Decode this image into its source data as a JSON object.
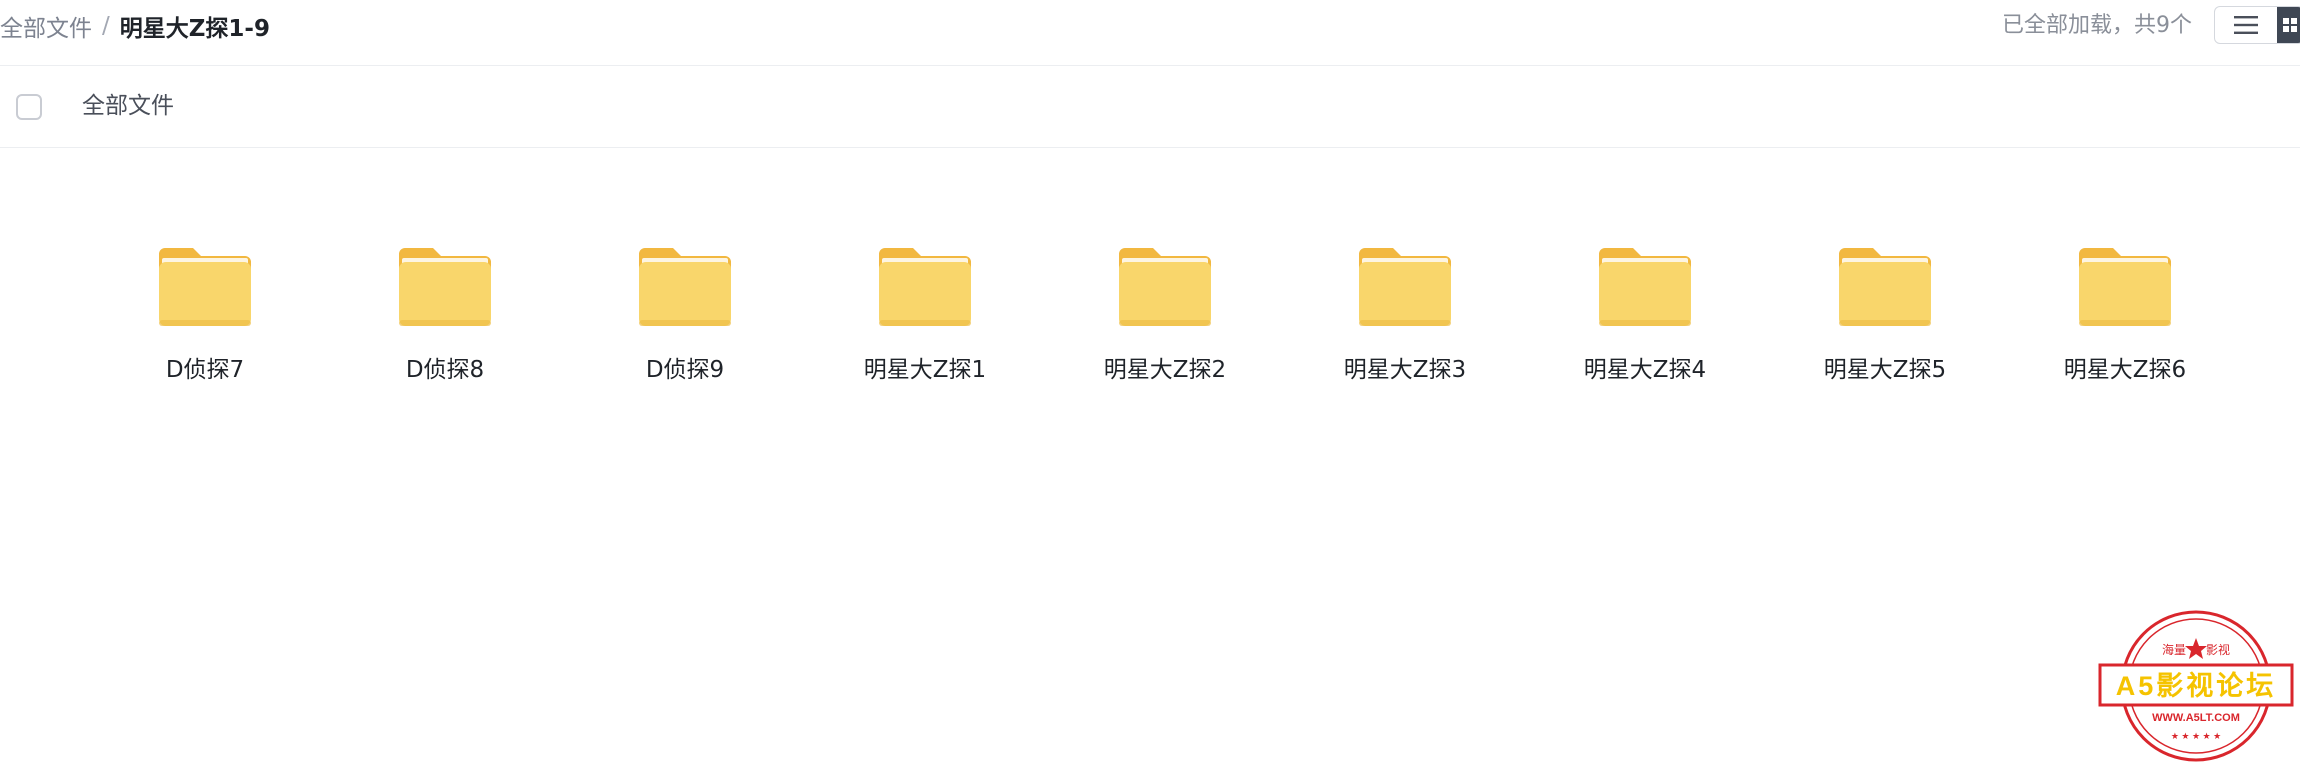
{
  "breadcrumb": {
    "root": "全部文件",
    "separator": "/",
    "current": "明星大Z探1-9"
  },
  "status": {
    "loaded_text": "已全部加载，共9个"
  },
  "view_toggle": {
    "list_icon": "list-icon",
    "grid_icon": "grid-icon"
  },
  "header": {
    "label": "全部文件"
  },
  "folders": [
    {
      "name": "D侦探7",
      "icon": "folder-icon"
    },
    {
      "name": "D侦探8",
      "icon": "folder-icon"
    },
    {
      "name": "D侦探9",
      "icon": "folder-icon"
    },
    {
      "name": "明星大Z探1",
      "icon": "folder-icon"
    },
    {
      "name": "明星大Z探2",
      "icon": "folder-icon"
    },
    {
      "name": "明星大Z探3",
      "icon": "folder-icon"
    },
    {
      "name": "明星大Z探4",
      "icon": "folder-icon"
    },
    {
      "name": "明星大Z探5",
      "icon": "folder-icon"
    },
    {
      "name": "明星大Z探6",
      "icon": "folder-icon"
    }
  ],
  "watermark": {
    "title": "A5影视论坛",
    "top_left": "海量",
    "top_right": "影视",
    "url": "WWW.A5LT.COM",
    "colors": {
      "ring": "#d9262c",
      "text": "#f5c300"
    }
  },
  "colors": {
    "folder_body": "#f9d66b",
    "folder_back": "#f2b840",
    "toggle_active": "#3f4754"
  }
}
